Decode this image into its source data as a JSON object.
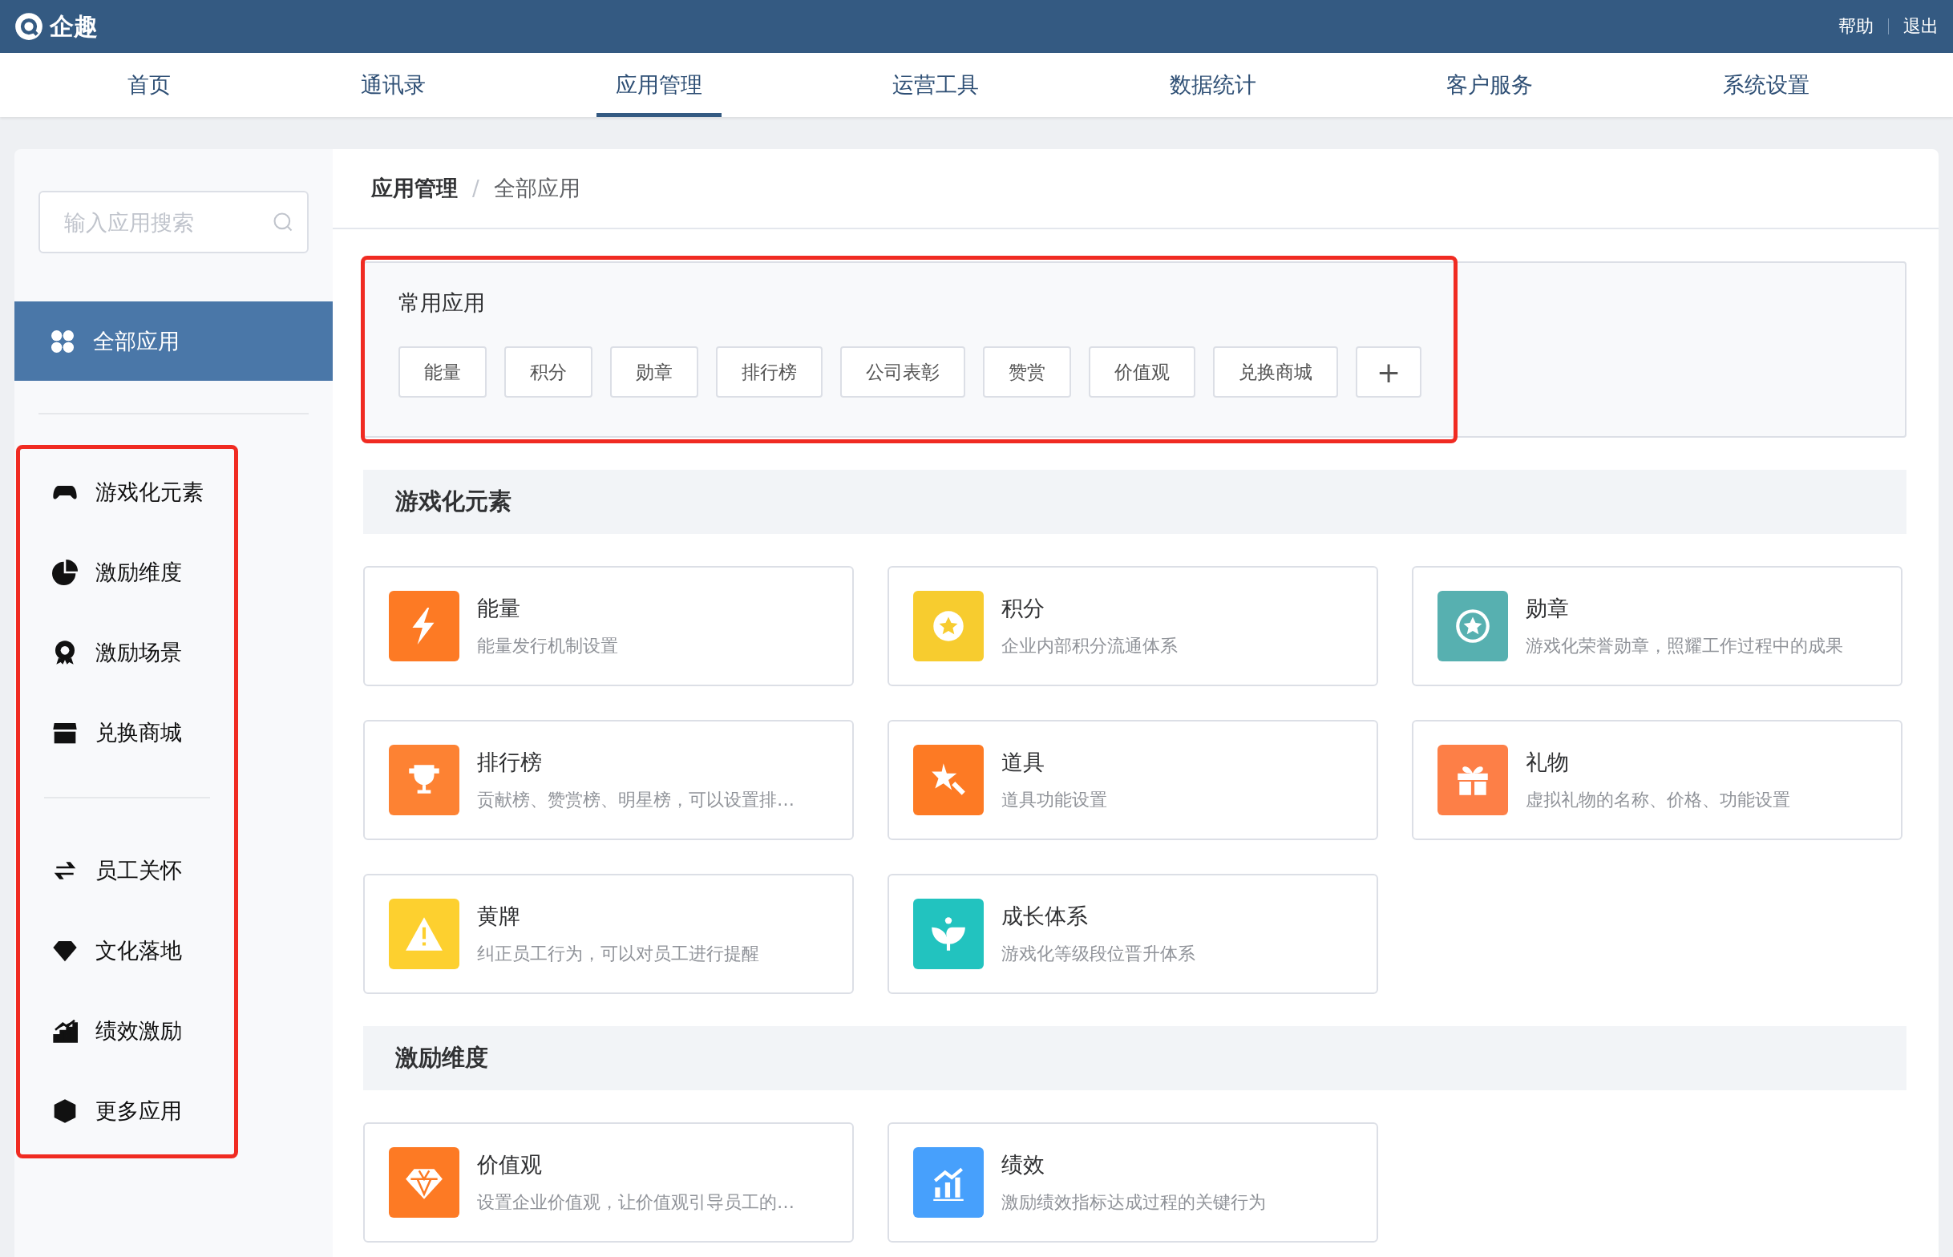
{
  "top_bar": {
    "logo": "企趣",
    "links": [
      "帮助",
      "退出"
    ]
  },
  "nav": [
    {
      "label": "首页",
      "selected": false
    },
    {
      "label": "通讯录",
      "selected": false
    },
    {
      "label": "应用管理",
      "selected": true
    },
    {
      "label": "运营工具",
      "selected": false
    },
    {
      "label": "数据统计",
      "selected": false
    },
    {
      "label": "客户服务",
      "selected": false
    },
    {
      "label": "系统设置",
      "selected": false
    }
  ],
  "sidebar": {
    "search_placeholder": "输入应用搜索",
    "all_item": {
      "label": "全部应用",
      "selected": true
    },
    "highlighted": true,
    "groups": [
      {
        "items": [
          {
            "label": "游戏化元素",
            "selected": false
          },
          {
            "label": "激励维度",
            "selected": false
          },
          {
            "label": "激励场景",
            "selected": false
          },
          {
            "label": "兑换商城",
            "selected": false
          }
        ]
      },
      {
        "items": [
          {
            "label": "员工关怀",
            "selected": false
          },
          {
            "label": "文化落地",
            "selected": false
          },
          {
            "label": "绩效激励",
            "selected": false
          },
          {
            "label": "更多应用",
            "selected": false
          }
        ]
      }
    ]
  },
  "breadcrumb": {
    "items": [
      "应用管理",
      "全部应用"
    ],
    "separator": "/"
  },
  "common_apps": {
    "title": "常用应用",
    "highlighted": true,
    "tags": [
      "能量",
      "积分",
      "勋章",
      "排行榜",
      "公司表彰",
      "赞赏",
      "价值观",
      "兑换商城"
    ],
    "add_button": "+"
  },
  "sections": [
    {
      "title": "游戏化元素",
      "apps": [
        {
          "name": "能量",
          "description": "能量发行机制设置",
          "color": "#fd7a24"
        },
        {
          "name": "积分",
          "description": "企业内部积分流通体系",
          "color": "#f7cc2f"
        },
        {
          "name": "勋章",
          "description": "游戏化荣誉勋章，照耀工作过程中的成果",
          "color": "#57b0b0"
        },
        {
          "name": "排行榜",
          "description": "贡献榜、赞赏榜、明星榜，可以设置排…",
          "color": "#fd8233"
        },
        {
          "name": "道具",
          "description": "道具功能设置",
          "color": "#fd7a24"
        },
        {
          "name": "礼物",
          "description": "虚拟礼物的名称、价格、功能设置",
          "color": "#fd7f47"
        },
        {
          "name": "黄牌",
          "description": "纠正员工行为，可以对员工进行提醒",
          "color": "#fdd02f"
        },
        {
          "name": "成长体系",
          "description": "游戏化等级段位晋升体系",
          "color": "#22c3bf"
        }
      ]
    },
    {
      "title": "激励维度",
      "apps": [
        {
          "name": "价值观",
          "description": "设置企业价值观，让价值观引导员工的…",
          "color": "#fd7a24"
        },
        {
          "name": "绩效",
          "description": "激励绩效指标达成过程的关键行为",
          "color": "#47a0fc"
        }
      ]
    }
  ]
}
